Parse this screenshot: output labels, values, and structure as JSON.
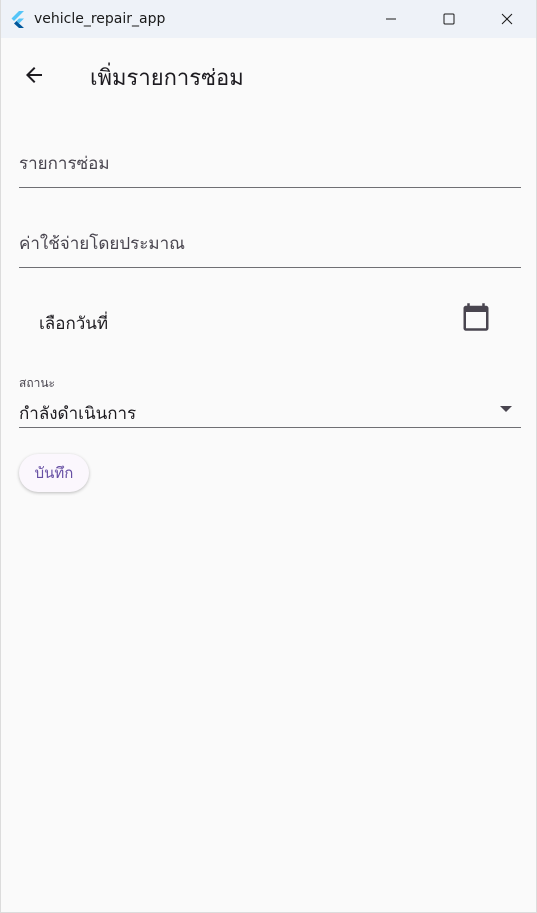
{
  "window": {
    "title": "vehicle_repair_app",
    "app_icon": "flutter-logo-icon",
    "controls": [
      "minimize-icon",
      "maximize-icon",
      "close-icon"
    ]
  },
  "appbar": {
    "back_icon": "arrow-back-icon",
    "title": "เพิ่มรายการซ่อม"
  },
  "form": {
    "repair_item_placeholder": "รายการซ่อม",
    "cost_placeholder": "ค่าใช้จ่ายโดยประมาณ",
    "date_label": "เลือกวันที่",
    "calendar_icon": "calendar-icon",
    "status": {
      "label": "สถานะ",
      "selected": "กำลังดำเนินการ"
    },
    "save_label": "บันทึก"
  },
  "colors": {
    "background": "#fafafa",
    "titlebar": "#eef2f8",
    "accent": "#6750a4",
    "underline": "#6f6f73"
  }
}
